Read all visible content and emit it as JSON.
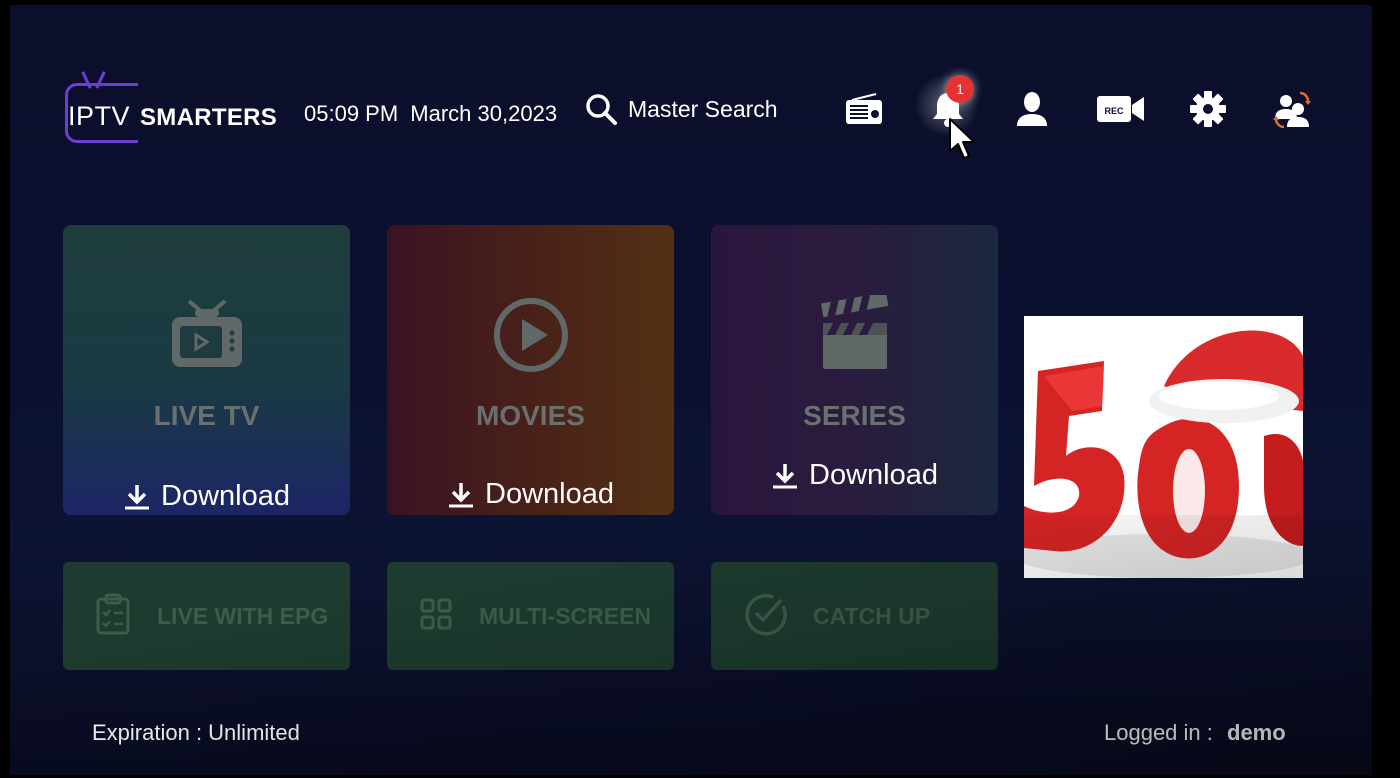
{
  "header": {
    "logo_prefix": "IPTV",
    "logo_suffix": "SMARTERS",
    "time": "05:09 PM",
    "date": "March 30,2023",
    "search_label": "Master Search",
    "notification_count": "1",
    "icons": [
      "radio-icon",
      "bell-icon",
      "user-icon",
      "rec-camera-icon",
      "gear-icon",
      "switch-user-icon"
    ]
  },
  "tiles": [
    {
      "label": "LIVE TV",
      "download": "Download",
      "icon": "tv-icon"
    },
    {
      "label": "MOVIES",
      "download": "Download",
      "icon": "play-icon"
    },
    {
      "label": "SERIES",
      "download": "Download",
      "icon": "clapperboard-icon"
    }
  ],
  "small_tiles": [
    {
      "label": "LIVE WITH EPG",
      "icon": "clipboard-icon"
    },
    {
      "label": "MULTI-SCREEN",
      "icon": "grid-icon"
    },
    {
      "label": "CATCH UP",
      "icon": "check-circle-icon"
    }
  ],
  "footer": {
    "expiration": "Expiration : Unlimited",
    "logged_in_label": "Logged in :",
    "username": "demo"
  },
  "colors": {
    "accent": "#6b3fd6",
    "badge": "#e63232",
    "small_tile_bg": "#1d3b2f"
  }
}
